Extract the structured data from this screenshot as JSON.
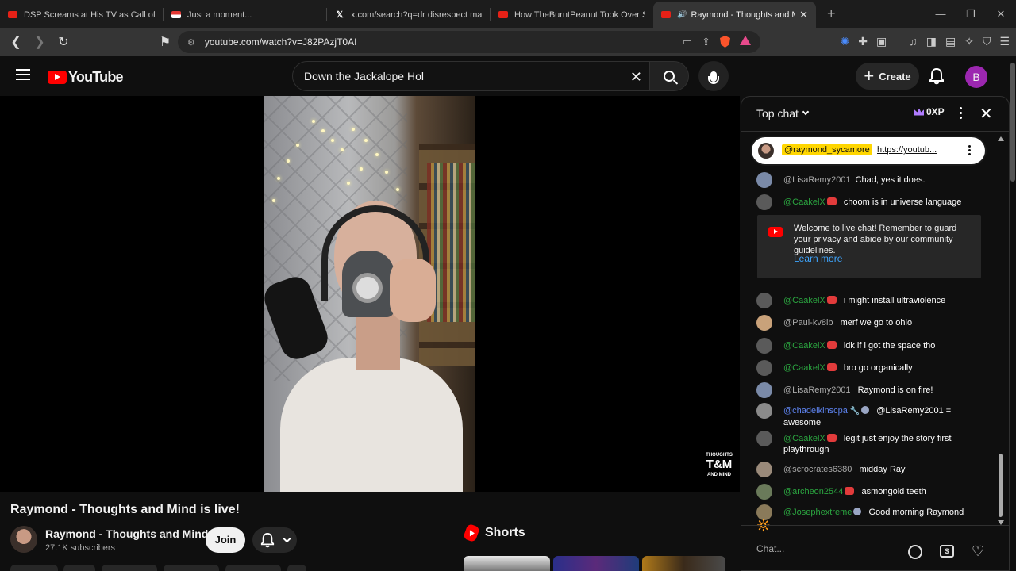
{
  "browser": {
    "tabs": [
      {
        "title": "DSP Screams at His TV as Call of Duty",
        "favicon": "youtube-icon"
      },
      {
        "title": "Just a moment...",
        "favicon": "flag-icon"
      },
      {
        "title": "x.com/search?q=dr disrespect madur",
        "favicon": "x-icon"
      },
      {
        "title": "How TheBurntPeanut Took Over Stre",
        "favicon": "youtube-icon"
      },
      {
        "title": "Raymond - Thoughts and Mind",
        "favicon": "youtube-icon",
        "active": true
      }
    ],
    "url": "youtube.com/watch?v=J82PAzjT0AI"
  },
  "header": {
    "logo_text": "YouTube",
    "search_value": "Down the Jackalope Hol",
    "create_label": "Create",
    "avatar_letter": "B",
    "avatar_color": "#9c27b0"
  },
  "video": {
    "watermark_top": "THOUGHTS",
    "watermark_big": "T&M",
    "watermark_bottom": "AND MIND"
  },
  "below_video": {
    "title": "Raymond - Thoughts and Mind is live!",
    "channel_name": "Raymond - Thoughts and Mind",
    "subscribers": "27.1K subscribers",
    "join_label": "Join",
    "shorts_label": "Shorts"
  },
  "chat": {
    "mode_label": "Top chat",
    "xp_label": "0XP",
    "pinned": {
      "author": "@raymond_sycamore",
      "link": "https://youtub..."
    },
    "messages_top": [
      {
        "author": "@LisaRemy2001",
        "text": "Chad, yes it does.",
        "color": "grey",
        "badge": ""
      },
      {
        "author": "@CaakelX",
        "text": "choom is in universe language",
        "color": "green",
        "badge": "member"
      }
    ],
    "welcome": {
      "text": "Welcome to live chat! Remember to guard your privacy and abide by our community guidelines.",
      "link": "Learn more"
    },
    "messages": [
      {
        "author": "@CaakelX",
        "text": "i might install ultraviolence",
        "color": "green",
        "badge": "member"
      },
      {
        "author": "@Paul-kv8lb",
        "text": "merf we go to ohio",
        "color": "grey",
        "badge": ""
      },
      {
        "author": "@CaakelX",
        "text": "idk if i got the space tho",
        "color": "green",
        "badge": "member"
      },
      {
        "author": "@CaakelX",
        "text": "bro go organically",
        "color": "green",
        "badge": "member"
      },
      {
        "author": "@LisaRemy2001",
        "text": "Raymond is on fire!",
        "color": "grey",
        "badge": ""
      },
      {
        "author": "@chadelkinscpa",
        "text": "@LisaRemy2001 = awesome",
        "color": "blue",
        "badge": "mod"
      },
      {
        "author": "@CaakelX",
        "text": "legit just enjoy the story first playthrough",
        "color": "green",
        "badge": "member"
      },
      {
        "author": "@scrocrates6380",
        "text": "midday Ray",
        "color": "grey",
        "badge": ""
      },
      {
        "author": "@archeon2544",
        "text": "asmongold teeth",
        "color": "green",
        "badge": "member"
      },
      {
        "author": "@Josephextreme",
        "text": "Good morning Raymond",
        "color": "green",
        "badge": "grey"
      }
    ],
    "sun_emoji": "🔆",
    "input_placeholder": "Chat..."
  },
  "colors": {
    "youtube_red": "#ff0000",
    "member_green": "#2ba640",
    "mod_blue": "#5e84f1",
    "link_blue": "#3ea6ff"
  }
}
